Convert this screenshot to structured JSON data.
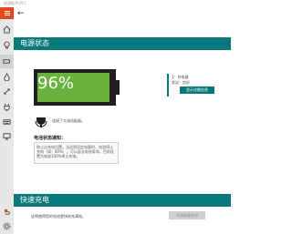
{
  "window": {
    "title": "电源助手(PC)"
  },
  "nav": {
    "items": [
      {
        "icon": "home-icon"
      },
      {
        "icon": "bulb-icon"
      },
      {
        "icon": "battery-icon"
      },
      {
        "icon": "flame-icon"
      },
      {
        "icon": "swap-icon"
      },
      {
        "icon": "plug-icon"
      },
      {
        "icon": "keyboard-icon"
      },
      {
        "icon": "monitor-icon"
      },
      {
        "icon": "weather-icon"
      },
      {
        "icon": "gear-icon"
      }
    ]
  },
  "power_status": {
    "header": "电源状态",
    "battery_percent": "96%",
    "battery_level": 0.96,
    "legend_line1": "1：充电器",
    "legend_line2": "状况：良好",
    "legend_button": "显示详细信息",
    "plugged_text": "连接了交流适配器。",
    "tip_title": "电池状态通知：",
    "tip_body": "防止过充电设置。当达到设定电量时，电池停止充电（如：80%）。可以延长电池寿命。目前设置为电池100%停止充电。"
  },
  "fast_charge": {
    "header": "快速充电",
    "description": "这将使得您的电池更快地充满电。",
    "button": "开始快速充电"
  },
  "colors": {
    "accent": "#08797b",
    "battery_fill": "#6ab23e",
    "menu_red": "#e8471c"
  }
}
